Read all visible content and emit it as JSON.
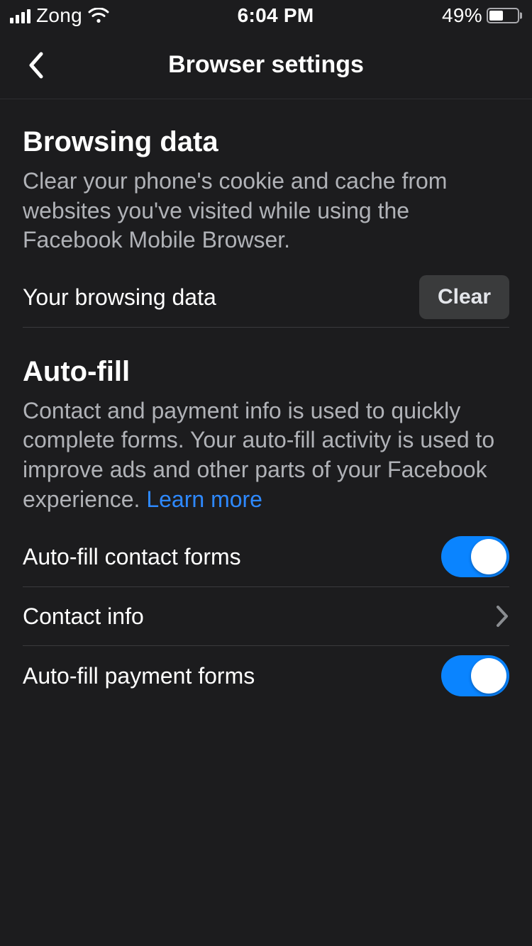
{
  "status": {
    "carrier": "Zong",
    "time": "6:04 PM",
    "battery_pct": "49%"
  },
  "header": {
    "title": "Browser settings"
  },
  "browsing": {
    "title": "Browsing data",
    "desc": "Clear your phone's cookie and cache from websites you've visited while using the Facebook Mobile Browser.",
    "row_label": "Your browsing data",
    "clear_button": "Clear"
  },
  "autofill": {
    "title": "Auto-fill",
    "desc_prefix": "Contact and payment info is used to quickly complete forms. Your auto-fill activity is used to improve ads and other parts of your Facebook experience. ",
    "learn_more": "Learn more",
    "contact_forms_label": "Auto-fill contact forms",
    "contact_forms_on": true,
    "contact_info_label": "Contact info",
    "payment_forms_label": "Auto-fill payment forms",
    "payment_forms_on": true
  }
}
